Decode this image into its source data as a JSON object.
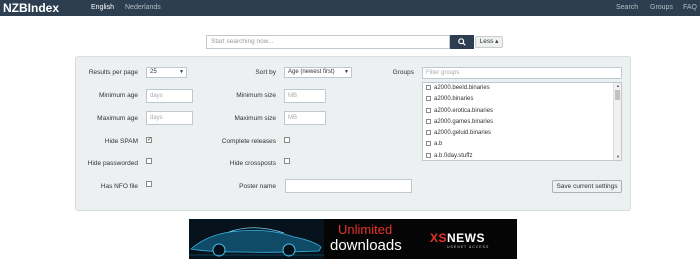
{
  "navbar": {
    "brand": "NZBIndex",
    "languages": [
      "English",
      "Nederlands"
    ],
    "links": [
      "Search",
      "Groups",
      "FAQ"
    ]
  },
  "search": {
    "placeholder": "Start searching now...",
    "less_label": "Less ▴"
  },
  "filters": {
    "results_per_page_label": "Results per page",
    "results_per_page_value": "25",
    "sort_by_label": "Sort by",
    "sort_by_value": "Age (newest first)",
    "groups_label": "Groups",
    "groups_filter_placeholder": "Filter groups",
    "minimum_age_label": "Minimum age",
    "minimum_age_placeholder": "days",
    "minimum_size_label": "Minimum size",
    "minimum_size_placeholder": "MB",
    "maximum_age_label": "Maximum age",
    "maximum_age_placeholder": "days",
    "maximum_size_label": "Maximum size",
    "maximum_size_placeholder": "MB",
    "hide_spam_label": "Hide SPAM",
    "hide_spam_checked": true,
    "complete_releases_label": "Complete releases",
    "hide_passworded_label": "Hide passworded",
    "hide_crossposts_label": "Hide crossposts",
    "has_nfo_label": "Has NFO file",
    "poster_name_label": "Poster name",
    "save_label": "Save current settings",
    "groups": [
      "a2000.beeld.binaries",
      "a2000.binaries",
      "a2000.erotica.binaries",
      "a2000.games.binaries",
      "a2000.geluid.binaries",
      "a.b",
      "a.b.0day.stuffz"
    ]
  },
  "banner": {
    "line1": "Unlimited",
    "line2": "downloads",
    "logo_xs": "XS",
    "logo_news": "NEWS",
    "logo_sub": "USENET ACCESS"
  },
  "colors": {
    "navbar": "#2c3e50",
    "panel": "#ecf0f1",
    "accent_red": "#e8332a"
  }
}
